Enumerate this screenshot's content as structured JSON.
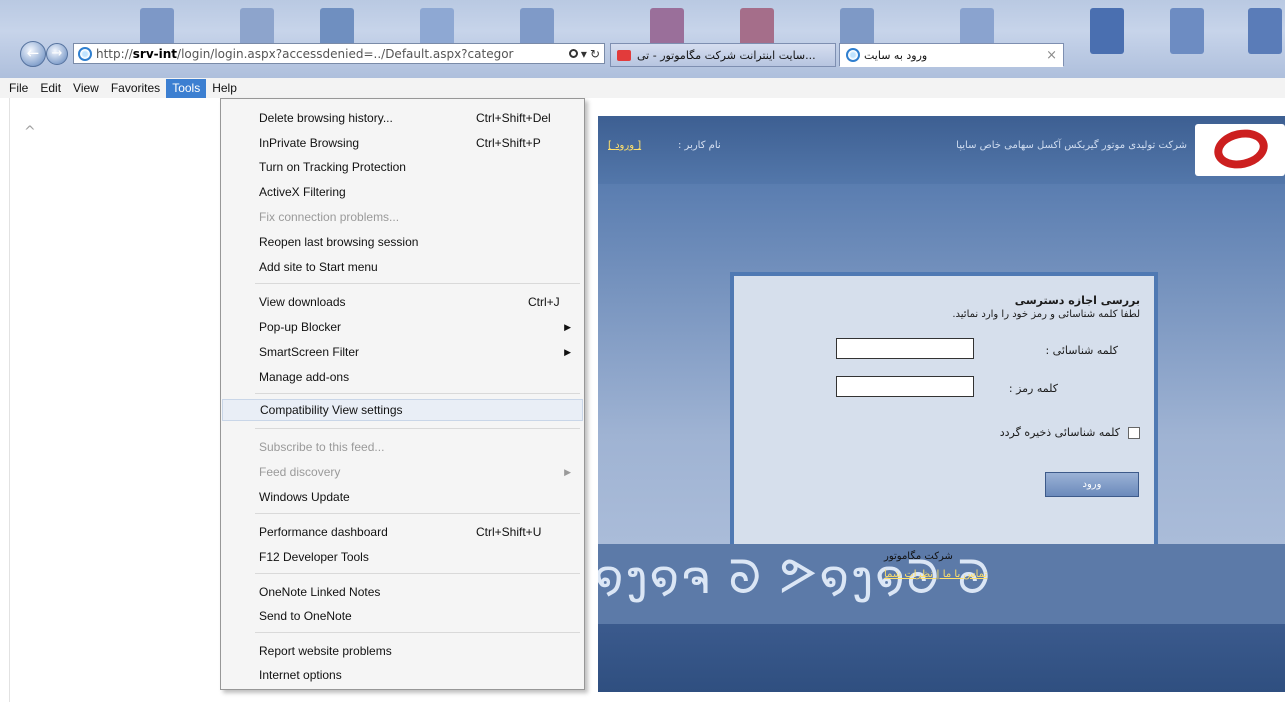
{
  "browser": {
    "address_url_dim_start": "http://",
    "address_url_host": "srv-int",
    "address_url_rest": "/login/login.aspx?accessdenied=../Default.aspx?categor",
    "search_symbol": "▾",
    "refresh_symbol": "↻",
    "tabs": [
      {
        "label": "...سایت اینترانت شرکت مگاموتور - تی",
        "active": false
      },
      {
        "label": "ورود به سایت",
        "active": true,
        "close_label": "×"
      }
    ]
  },
  "menubar": {
    "items": [
      {
        "label": "File",
        "active": false
      },
      {
        "label": "Edit",
        "active": false
      },
      {
        "label": "View",
        "active": false
      },
      {
        "label": "Favorites",
        "active": false
      },
      {
        "label": "Tools",
        "active": true
      },
      {
        "label": "Help",
        "active": false
      }
    ]
  },
  "tools_menu": {
    "items": [
      {
        "label": "Delete browsing history...",
        "shortcut": "Ctrl+Shift+Del",
        "disabled": false
      },
      {
        "label": "InPrivate Browsing",
        "shortcut": "Ctrl+Shift+P",
        "disabled": false
      },
      {
        "label": "Turn on Tracking Protection",
        "shortcut": "",
        "disabled": false
      },
      {
        "label": "ActiveX Filtering",
        "shortcut": "",
        "disabled": false
      },
      {
        "label": "Fix connection problems...",
        "shortcut": "",
        "disabled": true
      },
      {
        "label": "Reopen last browsing session",
        "shortcut": "",
        "disabled": false
      },
      {
        "label": "Add site to Start menu",
        "shortcut": "",
        "disabled": false
      },
      {
        "label": "View downloads",
        "shortcut": "Ctrl+J",
        "disabled": false
      },
      {
        "label": "Pop-up Blocker",
        "shortcut": "",
        "submenu": true,
        "disabled": false
      },
      {
        "label": "SmartScreen Filter",
        "shortcut": "",
        "submenu": true,
        "disabled": false
      },
      {
        "label": "Manage add-ons",
        "shortcut": "",
        "disabled": false
      },
      {
        "label": "Compatibility View settings",
        "shortcut": "",
        "disabled": false,
        "highlighted": true
      },
      {
        "label": "Subscribe to this feed...",
        "shortcut": "",
        "disabled": true
      },
      {
        "label": "Feed discovery",
        "shortcut": "",
        "submenu": true,
        "disabled": true
      },
      {
        "label": "Windows Update",
        "shortcut": "",
        "disabled": false
      },
      {
        "label": "Performance dashboard",
        "shortcut": "Ctrl+Shift+U",
        "disabled": false
      },
      {
        "label": "F12 Developer Tools",
        "shortcut": "",
        "disabled": false
      },
      {
        "label": "OneNote Linked Notes",
        "shortcut": "",
        "disabled": false
      },
      {
        "label": "Send to OneNote",
        "shortcut": "",
        "disabled": false
      },
      {
        "label": "Report website problems",
        "shortcut": "",
        "disabled": false
      },
      {
        "label": "Internet options",
        "shortcut": "",
        "disabled": false
      }
    ]
  },
  "page": {
    "header": {
      "company": "شرکت تولیدی موتور گیربکس آکسل سهامی خاص سایپا",
      "user_label": "نام کاربر :",
      "login_link": "[ ورود ]"
    },
    "login_box": {
      "title": "بررسی اجازه دسترسی",
      "subtitle": "لطفا کلمه شناسائی و رمز خود را وارد نمائید.",
      "username_label": "کلمه شناسائی :",
      "password_label": "کلمه رمز :",
      "remember_label": "کلمه شناسائی ذخیره گردد",
      "submit_label": "ورود"
    },
    "footer": {
      "company": "شرکت مگاموتور",
      "links": "تماس با ما | نظرات شما"
    }
  },
  "colors": {
    "menu_active": "#3c7fd1",
    "header_bg": "#3d5f92",
    "login_box_border": "#4f79b3",
    "link_yellow": "#ffe06a",
    "logo_red": "#cc1f1f"
  }
}
